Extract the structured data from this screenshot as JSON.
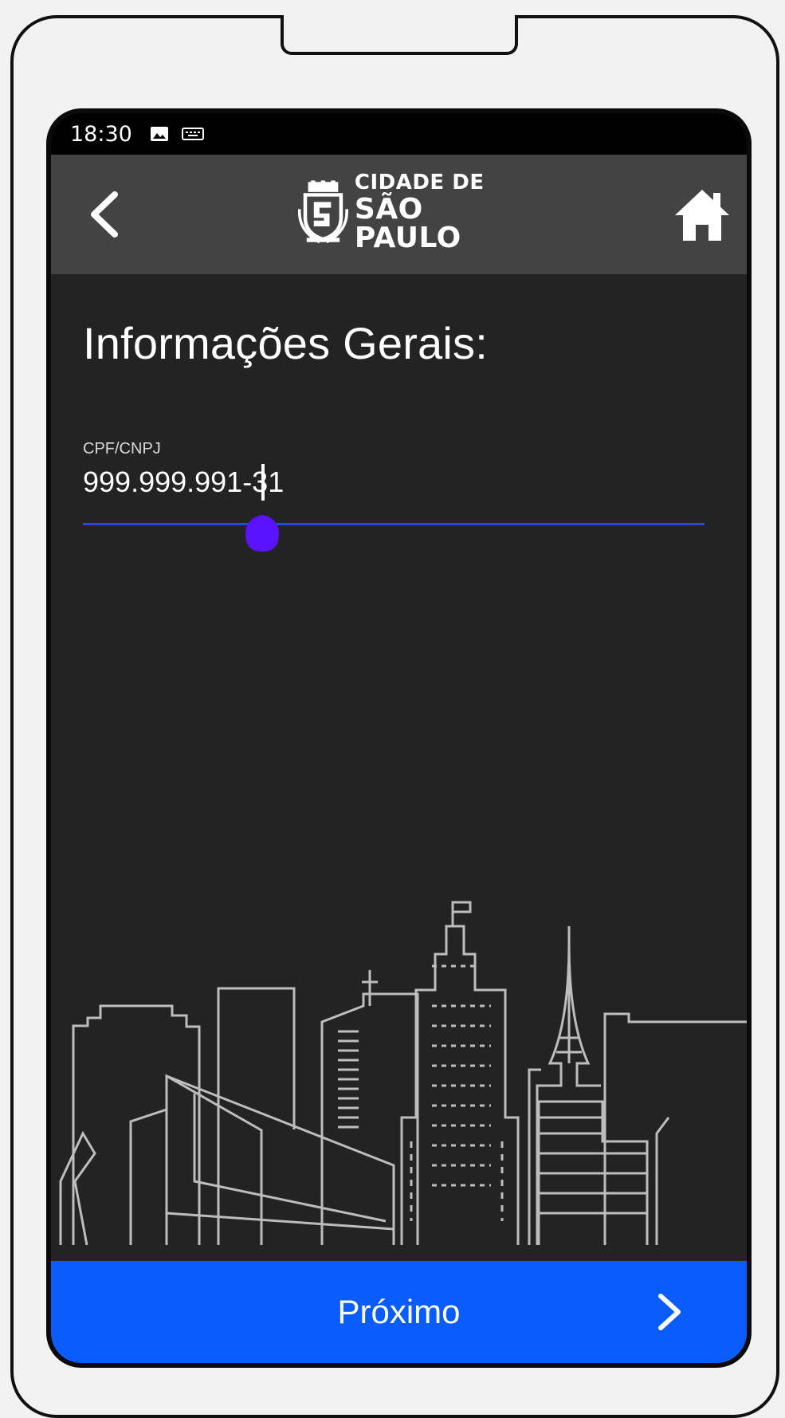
{
  "status_bar": {
    "time": "18:30",
    "icons": [
      "image-icon",
      "keyboard-icon"
    ]
  },
  "app_bar": {
    "logo_line1": "CIDADE DE",
    "logo_line2": "SÃO PAULO",
    "back_icon": "chevron-left-icon",
    "home_icon": "home-icon"
  },
  "page": {
    "title": "Informações Gerais:"
  },
  "form": {
    "cpf_label": "CPF/CNPJ",
    "cpf_value": "999.999.991-31"
  },
  "footer": {
    "next_label": "Próximo",
    "next_icon": "chevron-right-icon"
  },
  "colors": {
    "screen_bg": "#232323",
    "app_bar": "#434343",
    "accent_blue": "#0b5cff",
    "underline": "#1d4fd8",
    "handle": "#5b12ff"
  }
}
